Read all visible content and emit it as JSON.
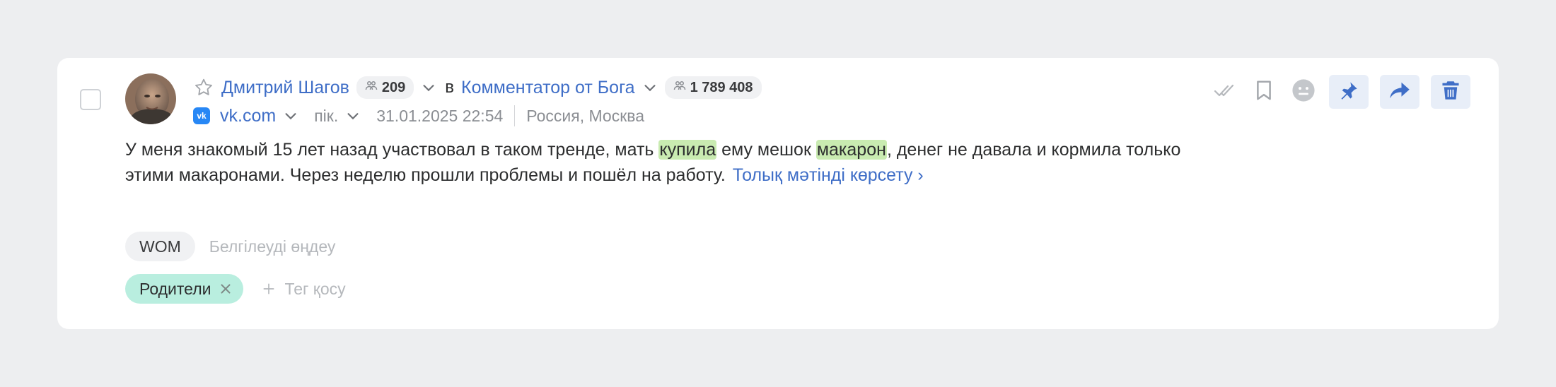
{
  "author": {
    "name": "Дмитрий Шагов",
    "followers": "209"
  },
  "preposition": "в",
  "community": {
    "name": "Комментатор от Бога",
    "followers": "1 789 408"
  },
  "source": {
    "logo_text": "vk",
    "name": "vk.com"
  },
  "type_label": "пік.",
  "datetime": "31.01.2025 22:54",
  "location": "Россия, Москва",
  "post": {
    "text_1": "У меня знакомый 15 лет назад участвовал в таком тренде, мать ",
    "highlight_1": "купила",
    "text_2": " ему мешок ",
    "highlight_2": "макарон",
    "text_3": ", денег не давала и кормила только этими макаронами. Через неделю прошли проблемы и пошёл на работу.",
    "show_more": "Толық мәтінді көрсету ›"
  },
  "markers": {
    "tag": "WOM",
    "edit_label": "Белгілеуді өңдеу"
  },
  "tags": {
    "items": [
      "Родители"
    ],
    "add_label": "Тег қосу"
  },
  "colors": {
    "link": "#3f6ec7",
    "highlight": "#c9ebb1",
    "tag_teal": "#b9eedf",
    "action_bg": "#e8eef8",
    "action_icon": "#3f6ec7"
  },
  "icons": [
    "star-icon",
    "people-icon",
    "chevron-down-icon",
    "check-icon",
    "bookmark-icon",
    "emoji-icon",
    "pin-icon",
    "share-icon",
    "trash-icon",
    "close-icon",
    "plus-icon"
  ]
}
